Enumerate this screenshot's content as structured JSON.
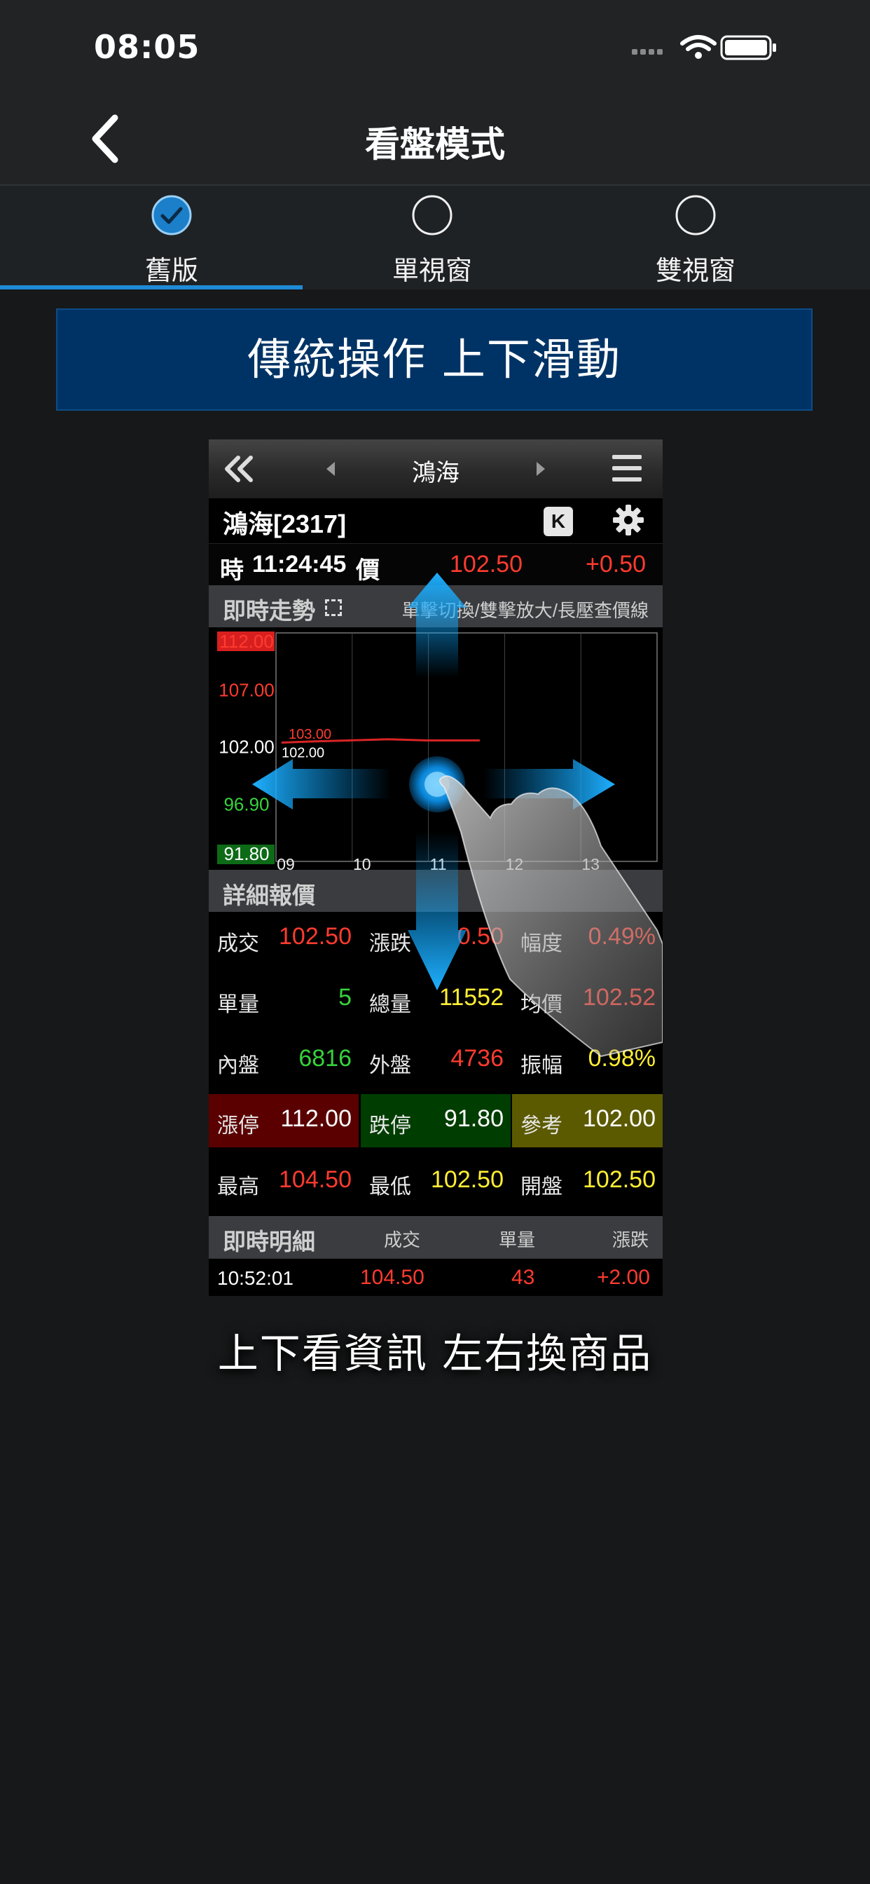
{
  "status_bar": {
    "time": "08:05"
  },
  "nav": {
    "title": "看盤模式"
  },
  "tabs": [
    {
      "label": "舊版",
      "selected": true
    },
    {
      "label": "單視窗",
      "selected": false
    },
    {
      "label": "雙視窗",
      "selected": false
    }
  ],
  "banner": {
    "text": "傳統操作 上下滑動"
  },
  "preview": {
    "stock_name": "鴻海",
    "stock_code": "鴻海[2317]",
    "k_label": "K",
    "quote_row": {
      "time_label": "時",
      "time": "11:24:45",
      "price_label": "價",
      "price": "102.50",
      "change": "+0.50"
    },
    "trend_header": {
      "title": "即時走勢",
      "hint": "單擊切換/雙擊放大/長壓查價線"
    },
    "detail_header": "詳細報價",
    "quotes": [
      [
        {
          "k": "成交",
          "v": "102.50",
          "c": "#ff3b2f"
        },
        {
          "k": "漲跌",
          "v": "0.50",
          "c": "#ff3b2f"
        },
        {
          "k": "幅度",
          "v": "0.49%",
          "c": "#ff3b2f"
        }
      ],
      [
        {
          "k": "單量",
          "v": "5",
          "c": "#36d23c"
        },
        {
          "k": "總量",
          "v": "11552",
          "c": "#ffee33"
        },
        {
          "k": "均價",
          "v": "102.52",
          "c": "#ff3b2f"
        }
      ],
      [
        {
          "k": "內盤",
          "v": "6816",
          "c": "#36d23c"
        },
        {
          "k": "外盤",
          "v": "4736",
          "c": "#ff3b2f"
        },
        {
          "k": "振幅",
          "v": "0.98%",
          "c": "#ffee33"
        }
      ],
      [
        {
          "k": "漲停",
          "v": "112.00",
          "c": "#ffffff",
          "bg": "#5a0000"
        },
        {
          "k": "跌停",
          "v": "91.80",
          "c": "#ffffff",
          "bg": "#003d00"
        },
        {
          "k": "參考",
          "v": "102.00",
          "c": "#ffffff",
          "bg": "#5c5a00"
        }
      ],
      [
        {
          "k": "最高",
          "v": "104.50",
          "c": "#ff3b2f"
        },
        {
          "k": "最低",
          "v": "102.50",
          "c": "#ffee33"
        },
        {
          "k": "開盤",
          "v": "102.50",
          "c": "#ffee33"
        }
      ]
    ],
    "list_header": {
      "title": "即時明細",
      "c1": "成交",
      "c2": "單量",
      "c3": "漲跌"
    },
    "list_row": {
      "time": "10:52:01",
      "price": "104.50",
      "vol": "43",
      "chg": "+2.00"
    }
  },
  "chart_data": {
    "type": "line",
    "y_tick_labels": [
      "112.00",
      "107.00",
      "102.00",
      "96.90",
      "91.80"
    ],
    "y_tick_colors": [
      "#ff3b2f",
      "#ff3b2f",
      "#ffffff",
      "#36d23c",
      "#ffffff"
    ],
    "x_tick_labels": [
      "09",
      "10",
      "11",
      "12",
      "13"
    ],
    "high_label": "103.00",
    "ref_label": "102.00",
    "ylim": [
      91.8,
      112.0
    ],
    "series": [
      {
        "x": [
          0,
          0.08,
          0.18,
          0.28,
          0.38,
          0.46,
          0.52
        ],
        "values": [
          102.3,
          102.4,
          102.5,
          102.6,
          102.5,
          102.5,
          102.5
        ]
      }
    ]
  },
  "caption": "上下看資訊 左右換商品"
}
